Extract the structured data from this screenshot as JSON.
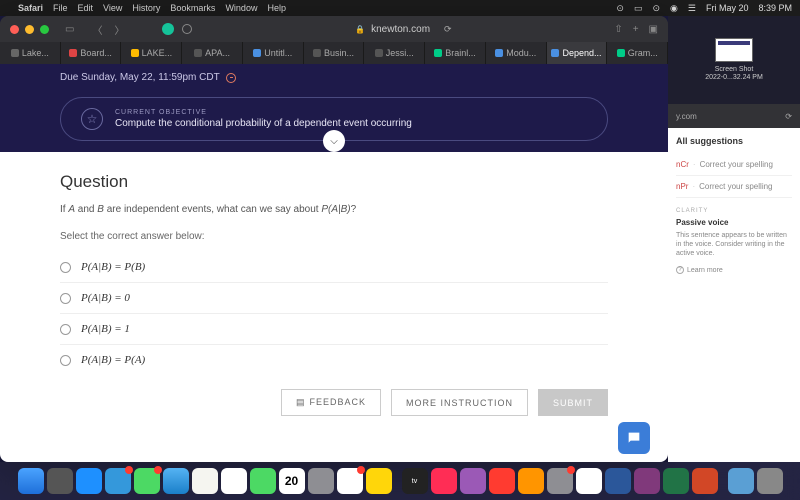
{
  "menubar": {
    "app": "Safari",
    "items": [
      "File",
      "Edit",
      "View",
      "History",
      "Bookmarks",
      "Window",
      "Help"
    ],
    "date": "Fri May 20",
    "time": "8:39 PM"
  },
  "browser": {
    "url": "knewton.com",
    "tabs": [
      {
        "label": "Lake...",
        "color": "#666"
      },
      {
        "label": "Board...",
        "color": "#d44"
      },
      {
        "label": "LAKE...",
        "color": "#fb0"
      },
      {
        "label": "APA...",
        "color": "#555"
      },
      {
        "label": "Untitl...",
        "color": "#4a90e2"
      },
      {
        "label": "Busin...",
        "color": "#555"
      },
      {
        "label": "Jessi...",
        "color": "#555"
      },
      {
        "label": "Brainl...",
        "color": "#0c8"
      },
      {
        "label": "Modu...",
        "color": "#4a90e2"
      },
      {
        "label": "Depend...",
        "color": "#4a90e2",
        "active": true
      },
      {
        "label": "Gram...",
        "color": "#0c8"
      }
    ]
  },
  "knewton": {
    "due": "Due Sunday, May 22, 11:59pm CDT",
    "objective_label": "CURRENT OBJECTIVE",
    "objective_desc": "Compute the conditional probability of a dependent event occurring",
    "question_title": "Question",
    "question_text_pre": "If ",
    "question_text_mid1": " and ",
    "question_text_mid2": " are independent events, what can we say about ",
    "question_text_post": "?",
    "varA": "A",
    "varB": "B",
    "pab": "P(A|B)",
    "select_prompt": "Select the correct answer below:",
    "answers": [
      "P(A|B) = P(B)",
      "P(A|B) = 0",
      "P(A|B) = 1",
      "P(A|B) = P(A)"
    ],
    "feedback_btn": "FEEDBACK",
    "more_btn": "MORE INSTRUCTION",
    "submit_btn": "SUBMIT"
  },
  "sidebar": {
    "thumb_title": "Screen Shot",
    "thumb_sub": "2022-0...32.24 PM",
    "url": "y.com",
    "header": "All suggestions",
    "sugg": [
      {
        "tag": "nCr",
        "txt": "Correct your spelling"
      },
      {
        "tag": "nPr",
        "txt": "Correct your spelling"
      }
    ],
    "clarity_label": "CLARITY",
    "passive_title": "Passive voice",
    "passive_desc": "This sentence appears to be written in the voice. Consider writing in the active voice.",
    "learn": "Learn more"
  }
}
